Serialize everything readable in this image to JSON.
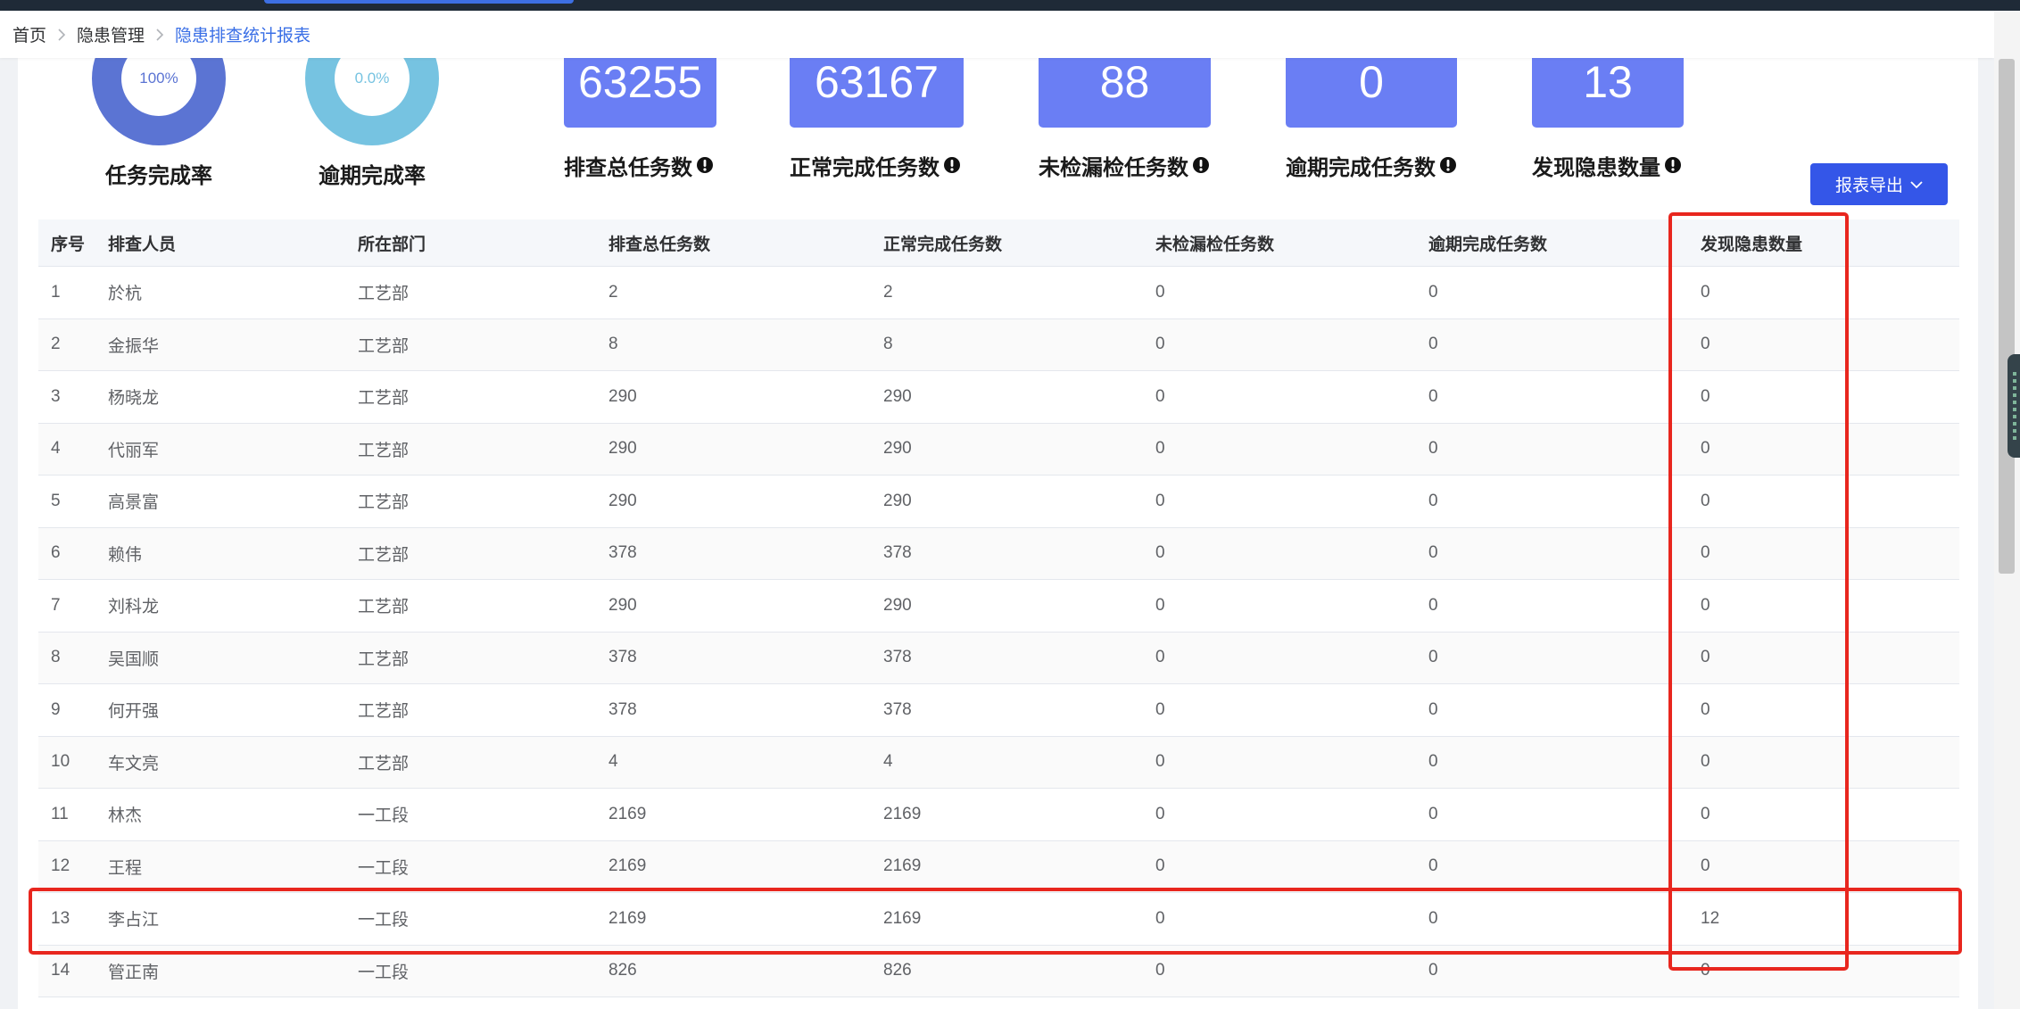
{
  "breadcrumb": {
    "items": [
      "首页",
      "隐患管理",
      "隐患排查统计报表"
    ]
  },
  "rates": [
    {
      "label": "任务完成率",
      "value_text": "100%",
      "color": "#5b74d3"
    },
    {
      "label": "逾期完成率",
      "value_text": "0.0%",
      "color": "#76c3e1"
    }
  ],
  "stats": [
    {
      "value": "63255",
      "label": "排查总任务数"
    },
    {
      "value": "63167",
      "label": "正常完成任务数"
    },
    {
      "value": "88",
      "label": "未检漏检任务数"
    },
    {
      "value": "0",
      "label": "逾期完成任务数"
    },
    {
      "value": "13",
      "label": "发现隐患数量"
    }
  ],
  "export_button": {
    "label": "报表导出"
  },
  "table": {
    "columns": [
      "序号",
      "排查人员",
      "所在部门",
      "排查总任务数",
      "正常完成任务数",
      "未检漏检任务数",
      "逾期完成任务数",
      "发现隐患数量"
    ],
    "rows": [
      [
        "1",
        "於杭",
        "工艺部",
        "2",
        "2",
        "0",
        "0",
        "0"
      ],
      [
        "2",
        "金振华",
        "工艺部",
        "8",
        "8",
        "0",
        "0",
        "0"
      ],
      [
        "3",
        "杨晓龙",
        "工艺部",
        "290",
        "290",
        "0",
        "0",
        "0"
      ],
      [
        "4",
        "代丽军",
        "工艺部",
        "290",
        "290",
        "0",
        "0",
        "0"
      ],
      [
        "5",
        "高景富",
        "工艺部",
        "290",
        "290",
        "0",
        "0",
        "0"
      ],
      [
        "6",
        "赖伟",
        "工艺部",
        "378",
        "378",
        "0",
        "0",
        "0"
      ],
      [
        "7",
        "刘科龙",
        "工艺部",
        "290",
        "290",
        "0",
        "0",
        "0"
      ],
      [
        "8",
        "吴国顺",
        "工艺部",
        "378",
        "378",
        "0",
        "0",
        "0"
      ],
      [
        "9",
        "何开强",
        "工艺部",
        "378",
        "378",
        "0",
        "0",
        "0"
      ],
      [
        "10",
        "车文亮",
        "工艺部",
        "4",
        "4",
        "0",
        "0",
        "0"
      ],
      [
        "11",
        "林杰",
        "一工段",
        "2169",
        "2169",
        "0",
        "0",
        "0"
      ],
      [
        "12",
        "王程",
        "一工段",
        "2169",
        "2169",
        "0",
        "0",
        "0"
      ],
      [
        "13",
        "李占江",
        "一工段",
        "2169",
        "2169",
        "0",
        "0",
        "12"
      ],
      [
        "14",
        "管正南",
        "一工段",
        "826",
        "826",
        "0",
        "0",
        "0"
      ]
    ]
  },
  "colors": {
    "stat_box": "#6a7ef4",
    "export_button": "#3456e8",
    "annotation_red": "#e8261e",
    "breadcrumb_active": "#3a6fe6"
  }
}
